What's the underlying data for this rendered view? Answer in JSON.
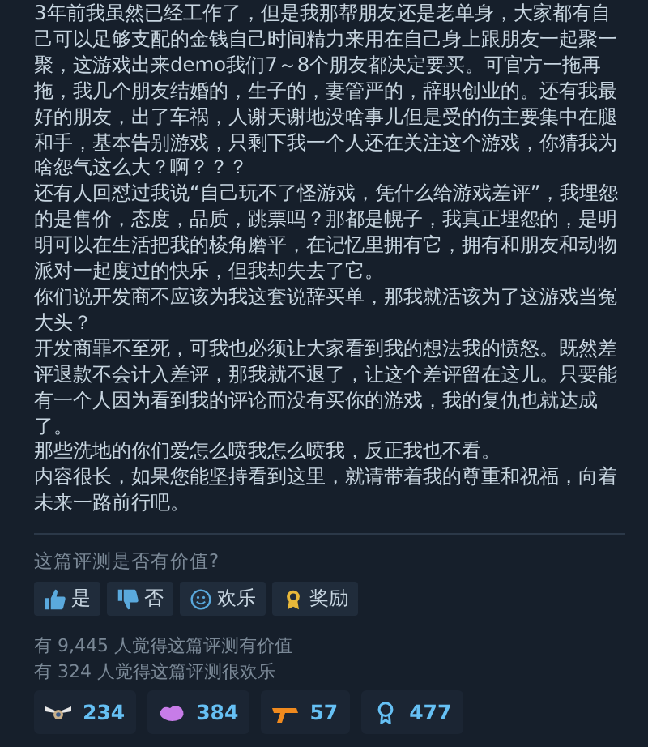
{
  "review": {
    "paragraphs": [
      "3年前我虽然已经工作了，但是我那帮朋友还是老单身，大家都有自己可以足够支配的金钱自己时间精力来用在自己身上跟朋友一起聚一聚，这游戏出来demo我们7～8个朋友都决定要买。可官方一拖再拖，我几个朋友结婚的，生子的，妻管严的，辞职创业的。还有我最好的朋友，出了车祸，人谢天谢地没啥事儿但是受的伤主要集中在腿和手，基本告别游戏，只剩下我一个人还在关注这个游戏，你猜我为啥怨气这么大？啊？？？",
      "还有人回怼过我说“自己玩不了怪游戏，凭什么给游戏差评”，我埋怨的是售价，态度，品质，跳票吗？那都是幌子，我真正埋怨的，是明明可以在生活把我的棱角磨平，在记忆里拥有它，拥有和朋友和动物派对一起度过的快乐，但我却失去了它。",
      "你们说开发商不应该为我这套说辞买单，那我就活该为了这游戏当冤大头？",
      "开发商罪不至死，可我也必须让大家看到我的想法我的愤怒。既然差评退款不会计入差评，那我就不退了，让这个差评留在这儿。只要能有一个人因为看到我的评论而没有买你的游戏，我的复仇也就达成了。",
      "那些洗地的你们爱怎么喷我怎么喷我，反正我也不看。",
      "内容很长，如果您能坚持看到这里，就请带着我的尊重和祝福，向着未来一路前行吧。"
    ]
  },
  "helpful_prompt": "这篇评测是否有价值?",
  "vote_buttons": [
    {
      "kind": "yes",
      "label": "是"
    },
    {
      "kind": "no",
      "label": "否"
    },
    {
      "kind": "funny",
      "label": "欢乐"
    },
    {
      "kind": "award",
      "label": "奖励"
    }
  ],
  "stats": [
    "有 9,445 人觉得这篇评测有价值",
    "有 324 人觉得这篇评测很欢乐"
  ],
  "awards": [
    {
      "kind": "wings",
      "count": "234"
    },
    {
      "kind": "blob",
      "count": "384"
    },
    {
      "kind": "gun",
      "count": "57"
    },
    {
      "kind": "ribbon",
      "count": "477"
    }
  ]
}
